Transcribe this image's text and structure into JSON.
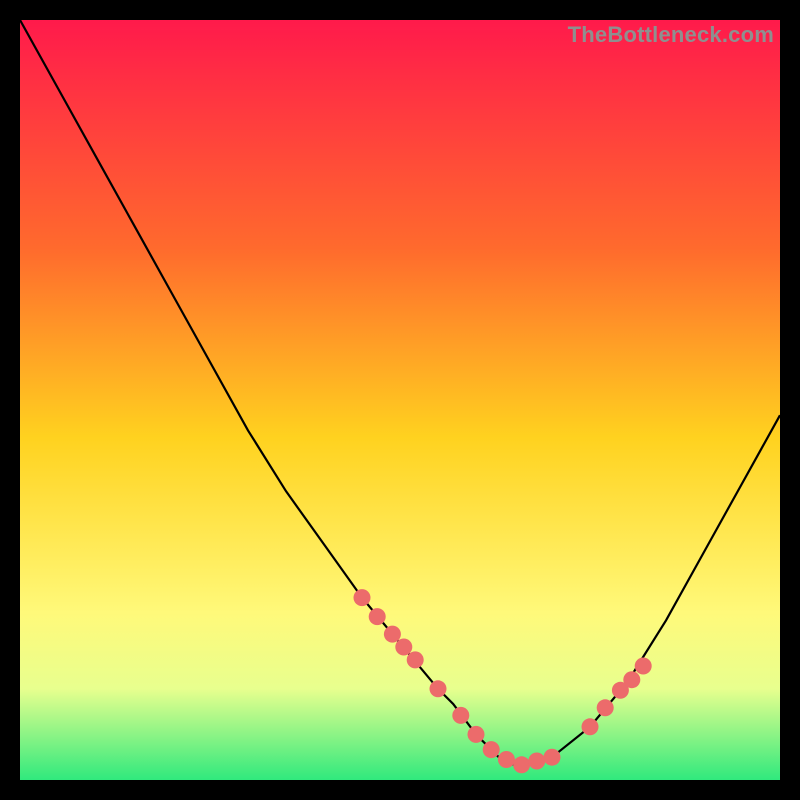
{
  "watermark": "TheBottleneck.com",
  "colors": {
    "bg_black": "#000000",
    "grad_top": "#ff1a4b",
    "grad_mid1": "#ff6a2d",
    "grad_mid2": "#ffd21f",
    "grad_low1": "#fff97a",
    "grad_low2": "#e8ff8e",
    "grad_bot": "#30e97d",
    "curve": "#000000",
    "marker": "#ec6b6b"
  },
  "chart_data": {
    "type": "line",
    "title": "",
    "xlabel": "",
    "ylabel": "",
    "xlim": [
      0,
      100
    ],
    "ylim": [
      0,
      100
    ],
    "grid": false,
    "legend": false,
    "series": [
      {
        "name": "bottleneck-curve",
        "x": [
          0,
          5,
          10,
          15,
          20,
          25,
          30,
          35,
          40,
          45,
          50,
          55,
          57,
          60,
          63,
          65,
          67,
          70,
          75,
          80,
          85,
          90,
          95,
          100
        ],
        "y": [
          100,
          91,
          82,
          73,
          64,
          55,
          46,
          38,
          31,
          24,
          18,
          12,
          10,
          6,
          3,
          2,
          2,
          3,
          7,
          13,
          21,
          30,
          39,
          48
        ]
      }
    ],
    "markers": {
      "name": "highlight-dots",
      "x": [
        45,
        47,
        49,
        50.5,
        52,
        55,
        58,
        60,
        62,
        64,
        66,
        68,
        70,
        75,
        77,
        79,
        80.5,
        82
      ],
      "y": [
        24,
        21.5,
        19.2,
        17.5,
        15.8,
        12,
        8.5,
        6,
        4,
        2.7,
        2,
        2.5,
        3,
        7,
        9.5,
        11.8,
        13.2,
        15
      ]
    }
  }
}
